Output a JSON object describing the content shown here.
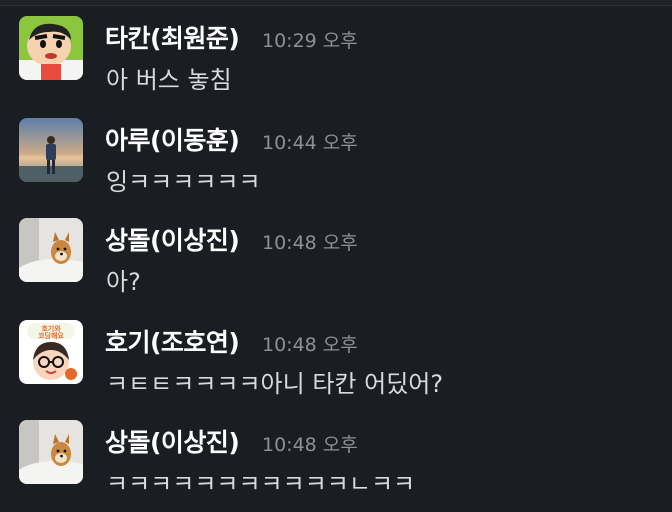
{
  "messages": [
    {
      "author": "타칸(최원준)",
      "time": "10:29 오후",
      "text": "아 버스 놓침",
      "avatar": "crayon-shinchan-avatar"
    },
    {
      "author": "아루(이동훈)",
      "time": "10:44 오후",
      "text": "잉ㅋㅋㅋㅋㅋㅋ",
      "avatar": "beach-person-avatar"
    },
    {
      "author": "상돌(이상진)",
      "time": "10:48 오후",
      "text": "아?",
      "avatar": "shiba-dog-avatar"
    },
    {
      "author": "호기(조호연)",
      "time": "10:48 오후",
      "text": "ㅋㅌㅌㅋㅋㅋㅋ아니 타칸 어딨어?",
      "avatar": "cartoon-face-avatar"
    },
    {
      "author": "상돌(이상진)",
      "time": "10:48 오후",
      "text": "ㅋㅋㅋㅋㅋㅋㅋㅋㅋㅋㅋㄴㅋㅋ",
      "avatar": "shiba-dog-avatar"
    }
  ],
  "avatar_badge_text": "호기와 코딩해요"
}
